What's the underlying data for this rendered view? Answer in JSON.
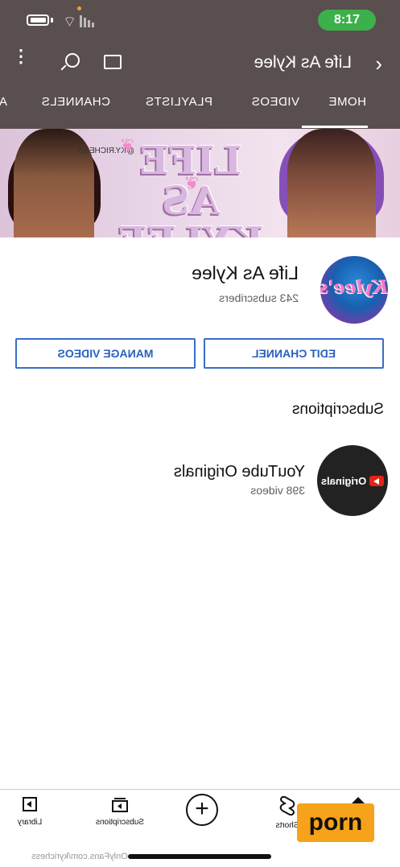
{
  "status_bar": {
    "time": "8:17"
  },
  "top_bar": {
    "back_glyph": "‹",
    "title": "Life As Kylee",
    "more_glyph": "⋮",
    "icons": [
      "back-icon",
      "cast-icon",
      "search-icon",
      "more-icon"
    ]
  },
  "tabs": [
    {
      "label": "HOME",
      "active": true
    },
    {
      "label": "VIDEOS"
    },
    {
      "label": "PLAYLISTS"
    },
    {
      "label": "CHANNELS"
    },
    {
      "label": "A"
    }
  ],
  "banner": {
    "logo_text": "LIFE AS KYLEE",
    "handle": "@KY.RICHESS"
  },
  "channel": {
    "avatar_text": "Kylee's",
    "name": "Life As Kylee",
    "subscribers": "243 subscribers"
  },
  "buttons": {
    "edit_channel": "EDIT CHANNEL",
    "manage_videos": "MANAGE VIDEOS"
  },
  "subscriptions": {
    "heading": "Subscriptions",
    "items": [
      {
        "logo_text": "Originals",
        "name": "YouTube Originals",
        "count": "398 videos"
      }
    ]
  },
  "bottom_nav": {
    "library": "Library",
    "subscriptions": "Subscriptions",
    "add": "+",
    "shorts": "Shorts"
  },
  "overlay": {
    "badge": "porn",
    "url": "OnlyFans.com/kyrichess"
  },
  "colors": {
    "header": "#5a4f4f",
    "accent_blue": "#3a6ec8",
    "time_pill": "#3cb04a",
    "badge": "#f7a21b"
  }
}
